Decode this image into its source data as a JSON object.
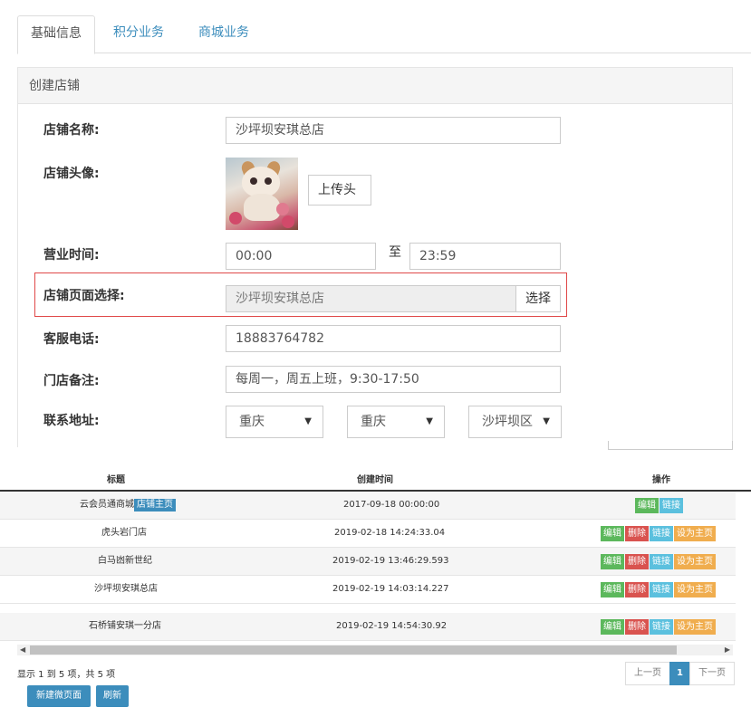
{
  "tabs": [
    {
      "label": "基础信息",
      "active": true
    },
    {
      "label": "积分业务",
      "active": false
    },
    {
      "label": "商城业务",
      "active": false
    }
  ],
  "panel_title": "创建店铺",
  "form": {
    "name_label": "店铺名称:",
    "name_value": "沙坪坝安琪总店",
    "avatar_label": "店铺头像:",
    "upload_button": "上传头",
    "hours_label": "营业时间:",
    "hours_start": "00:00",
    "hours_sep": "至",
    "hours_end": "23:59",
    "page_label": "店铺页面选择:",
    "page_value": "沙坪坝安琪总店",
    "page_select_button": "选择",
    "phone_label": "客服电话:",
    "phone_value": "18883764782",
    "note_label": "门店备注:",
    "note_value": "每周一，周五上班，9:30-17:50",
    "address_label": "联系地址:",
    "address_province": "重庆",
    "address_city": "重庆",
    "address_district": "沙坪坝区"
  },
  "table": {
    "headers": [
      "标题",
      "创建时间",
      "操作"
    ],
    "rows": [
      {
        "title": "云会员通商城",
        "tag": "店铺主页",
        "time": "2017-09-18 00:00:00",
        "actions": [
          "编辑",
          "链接"
        ]
      },
      {
        "title": "虎头岩门店",
        "tag": "",
        "time": "2019-02-18 14:24:33.04",
        "actions": [
          "编辑",
          "删除",
          "链接",
          "设为主页"
        ]
      },
      {
        "title": "白马凼新世纪",
        "tag": "",
        "time": "2019-02-19 13:46:29.593",
        "actions": [
          "编辑",
          "删除",
          "链接",
          "设为主页"
        ]
      },
      {
        "title": "沙坪坝安琪总店",
        "tag": "",
        "time": "2019-02-19 14:03:14.227",
        "actions": [
          "编辑",
          "删除",
          "链接",
          "设为主页"
        ]
      },
      {
        "title": "石桥铺安琪一分店",
        "tag": "",
        "time": "2019-02-19 14:54:30.92",
        "actions": [
          "编辑",
          "删除",
          "链接",
          "设为主页"
        ]
      }
    ],
    "info": "显示 1 到 5 项，共 5 项"
  },
  "pager": {
    "prev": "上一页",
    "current": "1",
    "next": "下一页"
  },
  "buttons": {
    "new_page": "新建微页面",
    "refresh": "刷新"
  },
  "colors": {
    "primary": "#3c8dbc",
    "edit": "#5cb85c",
    "delete": "#d9534f",
    "link": "#5bc0de",
    "set_home": "#f0ad4e",
    "highlight_border": "#e04848"
  },
  "icons": {
    "dropdown": "caret-down-icon",
    "scroll_left": "arrow-left-icon",
    "scroll_right": "arrow-right-icon"
  }
}
